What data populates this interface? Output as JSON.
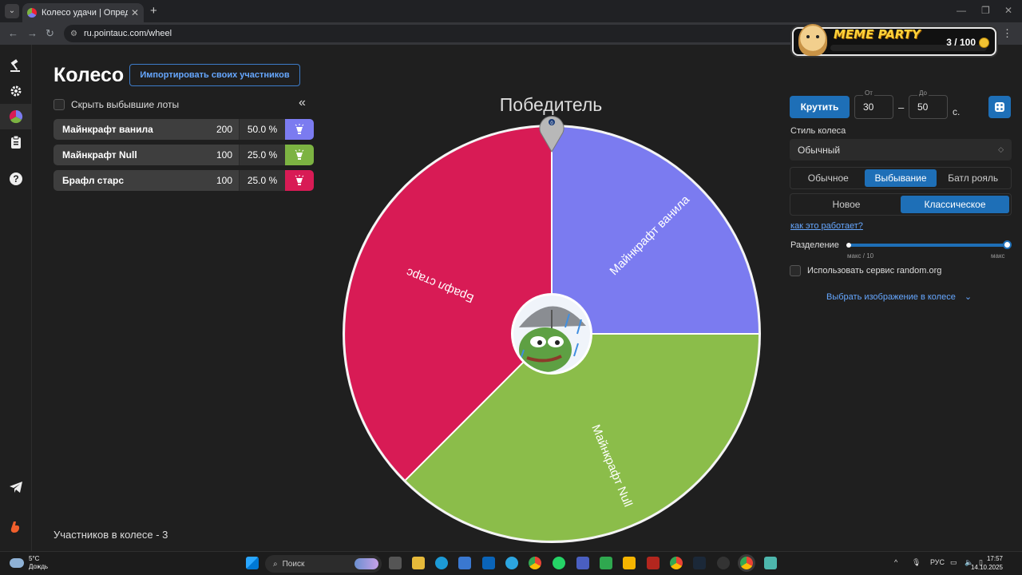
{
  "browser": {
    "tab_title": "Колесо удачи | Определите п",
    "url": "ru.pointauc.com/wheel"
  },
  "meme_party": {
    "title": "MEME PARTY",
    "count": "3 / 100"
  },
  "page": {
    "title": "Колесо",
    "import_button": "Импортировать своих участников",
    "hide_lots_label": "Скрыть выбывшие лоты",
    "participants_count": "Участников в колесе - 3"
  },
  "lots": [
    {
      "name": "Майнкрафт ванила",
      "amount": "200",
      "percent": "50.0 %",
      "color": "#7b7bf0"
    },
    {
      "name": "Майнкрафт Null",
      "amount": "100",
      "percent": "25.0 %",
      "color": "#7cb342"
    },
    {
      "name": "Брафл старс",
      "amount": "100",
      "percent": "25.0 %",
      "color": "#d81b55"
    }
  ],
  "wheel": {
    "winner_label": "Победитель",
    "pointer_value": "0",
    "segments": [
      {
        "label": "Майнкрафт ванила",
        "color": "#7b7bf0"
      },
      {
        "label": "Майнкрафт Null",
        "color": "#8bbd4a"
      },
      {
        "label": "Брафл старс",
        "color": "#d81b55"
      }
    ]
  },
  "controls": {
    "spin_button": "Крутить",
    "from_label": "От",
    "from_value": "30",
    "to_label": "До",
    "to_value": "50",
    "dash": "–",
    "unit": "с.",
    "style_label": "Стиль колеса",
    "style_value": "Обычный",
    "mode_options": [
      "Обычное",
      "Выбывание",
      "Батл рояль"
    ],
    "mode_selected": "Выбывание",
    "variant_options": [
      "Новое",
      "Классическое"
    ],
    "variant_selected": "Классическое",
    "how_link": "как это работает?",
    "split_label": "Разделение",
    "split_min_mark": "макс / 10",
    "split_max_mark": "макс",
    "split_fraction": 1.0,
    "random_org_label": "Использовать сервис random.org",
    "pick_image_label": "Выбрать изображение в колесе"
  },
  "taskbar": {
    "temperature": "5°C",
    "weather": "Дождь",
    "search_placeholder": "Поиск",
    "language": "РУС",
    "time": "17:57",
    "date": "14.10.2025"
  },
  "accent_color": "#1e6fb7"
}
